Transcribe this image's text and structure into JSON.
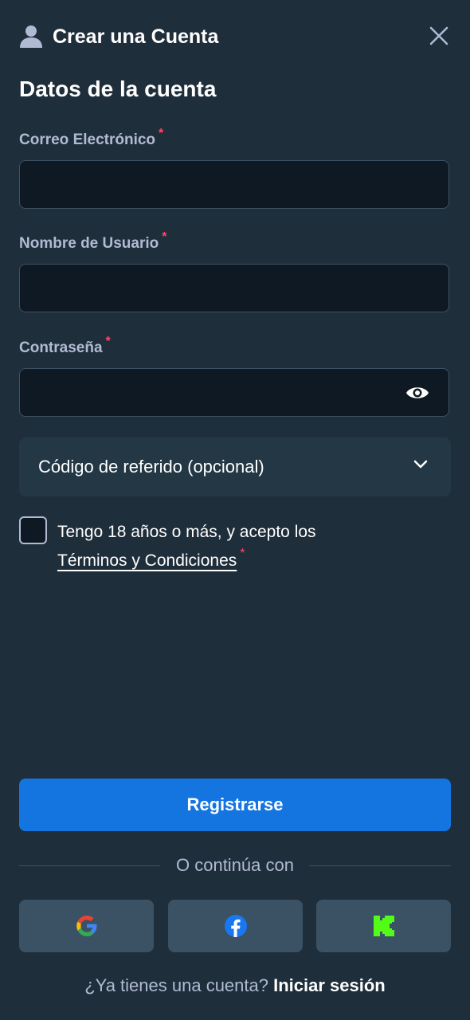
{
  "header": {
    "title": "Crear una Cuenta"
  },
  "section": {
    "title": "Datos de la cuenta"
  },
  "form": {
    "email_label": "Correo Electrónico",
    "email_value": "",
    "username_label": "Nombre de Usuario",
    "username_value": "",
    "password_label": "Contraseña",
    "password_value": "",
    "required_mark": "*"
  },
  "referral": {
    "label": "Código de referido (opcional)"
  },
  "terms": {
    "text": "Tengo 18 años o más, y acepto los",
    "link": "Términos y Condiciones",
    "checked": false
  },
  "register_label": "Registrarse",
  "divider_text": "O continúa con",
  "social": [
    "google-icon",
    "facebook-icon",
    "kick-icon"
  ],
  "footer": {
    "question": "¿Ya tienes una cuenta?",
    "login": "Iniciar sesión"
  },
  "colors": {
    "background": "#1f2e3b",
    "input_bg": "#0f1923",
    "accent": "#1475e1",
    "required": "#fa4a6a",
    "muted": "#b1bad3",
    "kick": "#53fc18"
  }
}
